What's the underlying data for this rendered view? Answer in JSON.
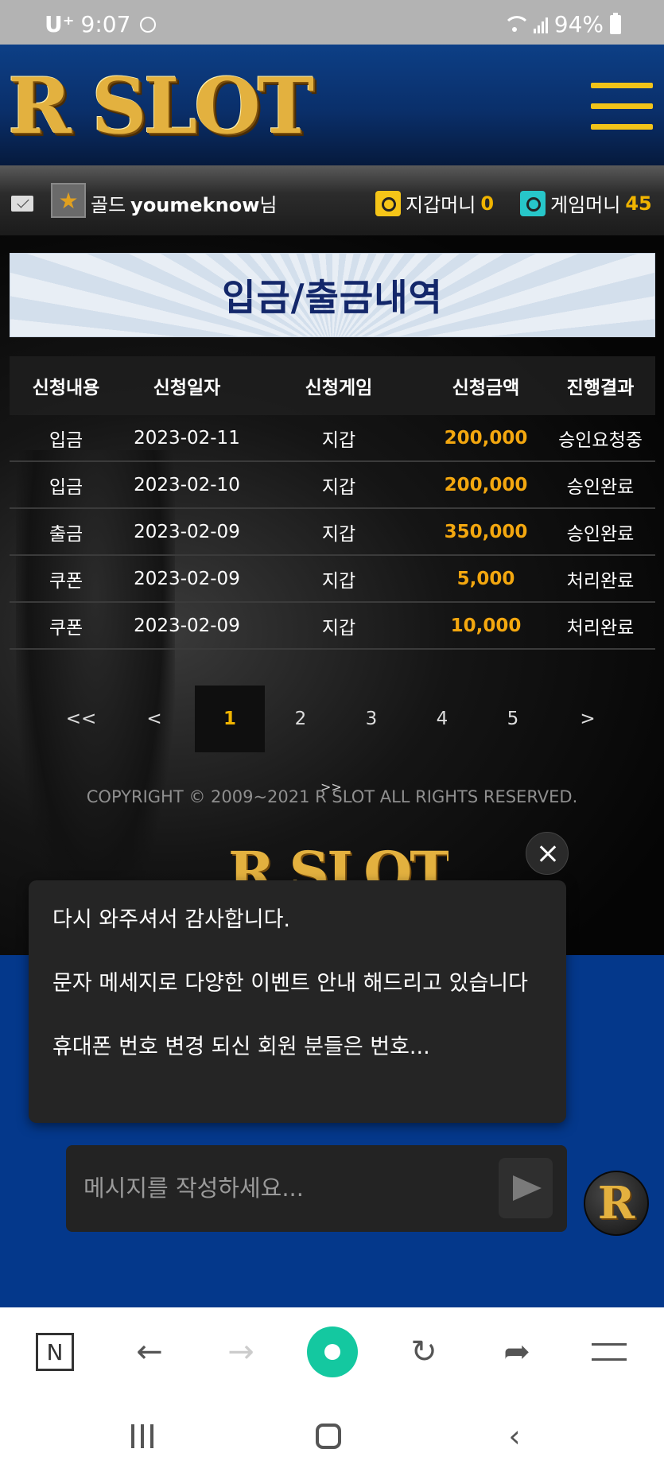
{
  "status_bar": {
    "carrier": "U⁺",
    "time": "9:07",
    "battery": "94%"
  },
  "header": {
    "logo_text": "R SLOT"
  },
  "user": {
    "rank": "골드",
    "user_id": "youmeknow",
    "suffix": "님",
    "wallet_label": "지갑머니",
    "wallet_value": "0",
    "game_label": "게임머니",
    "game_value": "45",
    "wallet_color": "#f5c518",
    "game_color": "#27c6c9"
  },
  "page_title": "입금/출금내역",
  "table": {
    "headers": [
      "신청내용",
      "신청일자",
      "신청게임",
      "신청금액",
      "진행결과"
    ],
    "rows": [
      [
        "입금",
        "2023-02-11",
        "지갑",
        "200,000",
        "승인요청중"
      ],
      [
        "입금",
        "2023-02-10",
        "지갑",
        "200,000",
        "승인완료"
      ],
      [
        "출금",
        "2023-02-09",
        "지갑",
        "350,000",
        "승인완료"
      ],
      [
        "쿠폰",
        "2023-02-09",
        "지갑",
        "5,000",
        "처리완료"
      ],
      [
        "쿠폰",
        "2023-02-09",
        "지갑",
        "10,000",
        "처리완료"
      ]
    ]
  },
  "pagination": {
    "first": "<<",
    "prev": "<",
    "pages": [
      "1",
      "2",
      "3",
      "4",
      "5"
    ],
    "current": "1",
    "next": ">",
    "last": ">>"
  },
  "footer": {
    "copyright": "COPYRIGHT © 2009~2021 R SLOT ALL RIGHTS RESERVED.",
    "logo_text": "R SLOT"
  },
  "popup": {
    "line1": "다시 와주셔서 감사합니다.",
    "line2": "문자 메세지로 다양한 이벤트 안내 해드리고 있습니다",
    "line3": "휴대폰 번호 변경 되신 회원 분들은 번호..."
  },
  "chat": {
    "placeholder": "메시지를 작성하세요...",
    "fab_letter": "R"
  },
  "browser": {
    "n_label": "N"
  }
}
